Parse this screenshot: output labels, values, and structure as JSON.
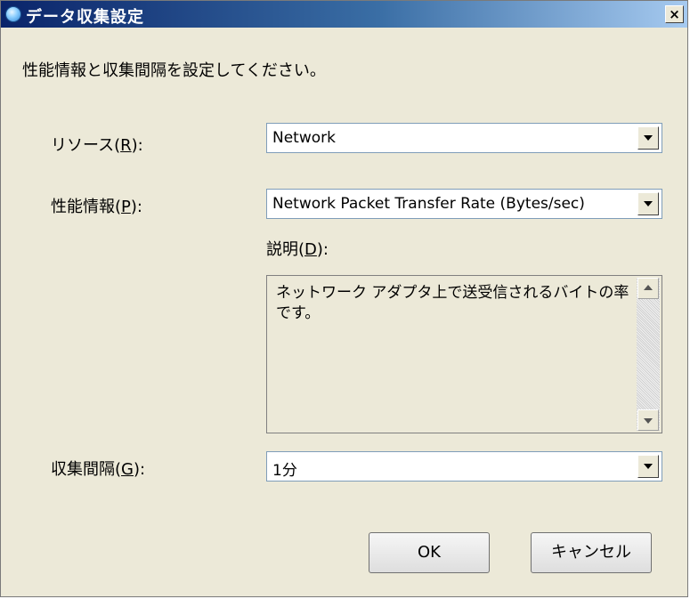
{
  "window": {
    "title": "データ収集設定",
    "close_label": "×"
  },
  "instruction": "性能情報と収集間隔を設定してください。",
  "resource": {
    "label": "リソース(",
    "mnemonic": "R",
    "label_end": "):",
    "value": "Network"
  },
  "perf": {
    "label": "性能情報(",
    "mnemonic": "P",
    "label_end": "):",
    "value": "Network Packet Transfer Rate (Bytes/sec)"
  },
  "description": {
    "label": "説明(",
    "mnemonic": "D",
    "label_end": "):",
    "text": "ネットワーク アダプタ上で送受信されるバイトの率です。"
  },
  "interval": {
    "label": "収集間隔(",
    "mnemonic": "G",
    "label_end": "):",
    "value": "1分"
  },
  "buttons": {
    "ok": "OK",
    "cancel": "キャンセル"
  },
  "icons": [
    "app-icon",
    "close-icon",
    "dropdown-arrow-icon",
    "scroll-up-icon",
    "scroll-down-icon"
  ]
}
